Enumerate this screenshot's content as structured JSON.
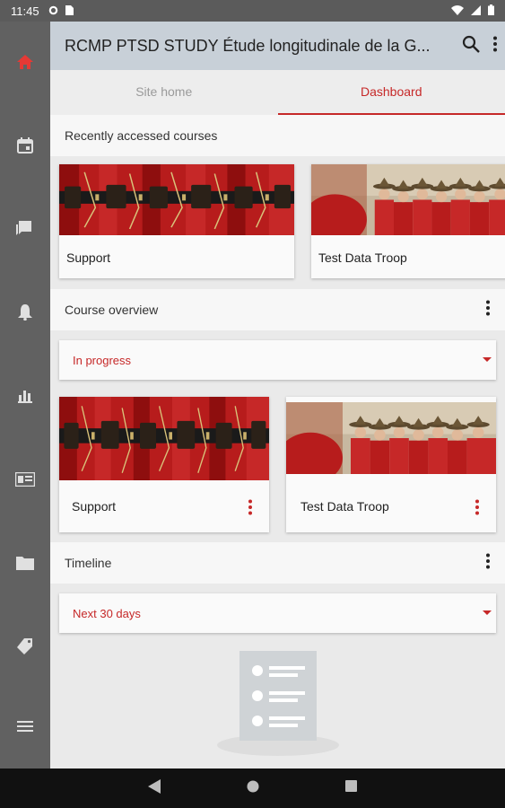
{
  "status_bar": {
    "time": "11:45",
    "icons": [
      "settings-icon",
      "sim-card-icon",
      "wifi-icon",
      "signal-icon",
      "battery-icon"
    ]
  },
  "sidebar": {
    "items": [
      {
        "name": "home-icon",
        "active": true
      },
      {
        "name": "calendar-icon"
      },
      {
        "name": "messages-icon"
      },
      {
        "name": "notifications-icon"
      },
      {
        "name": "grades-icon"
      },
      {
        "name": "contact-card-icon"
      },
      {
        "name": "folder-icon"
      },
      {
        "name": "tag-icon"
      },
      {
        "name": "menu-icon"
      }
    ],
    "active_color": "#e53935"
  },
  "app_bar": {
    "title": "RCMP PTSD STUDY Étude longitudinale de la G...",
    "icons": [
      "search-icon",
      "more-vert-icon"
    ]
  },
  "tabs": [
    {
      "label": "Site home",
      "active": false
    },
    {
      "label": "Dashboard",
      "active": true
    }
  ],
  "recent": {
    "header": "Recently accessed courses",
    "courses": [
      {
        "name": "Support",
        "image": "red-serge-belts"
      },
      {
        "name": "Test Data Troop",
        "image": "mounties-in-hats"
      }
    ]
  },
  "overview": {
    "header": "Course overview",
    "filter": "In progress",
    "courses": [
      {
        "name": "Support",
        "image": "red-serge-belts"
      },
      {
        "name": "Test Data Troop",
        "image": "mounties-in-hats"
      }
    ]
  },
  "timeline": {
    "header": "Timeline",
    "filter": "Next 30 days",
    "empty_icon": "empty-list-illustration"
  },
  "colors": {
    "accent": "#c62828",
    "app_bar": "#c8d0d8",
    "sidebar": "#616161"
  }
}
